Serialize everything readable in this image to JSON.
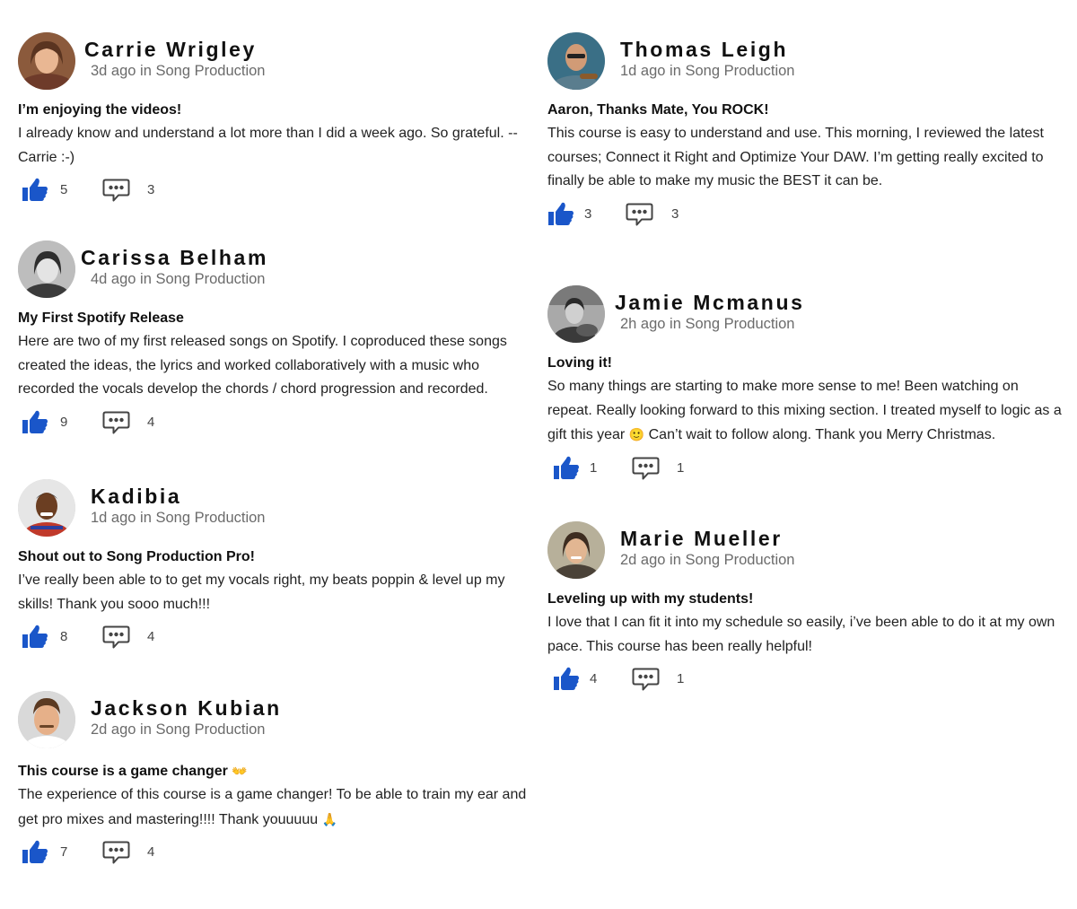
{
  "posts": [
    {
      "name": "Carrie Wrigley",
      "meta": "3d ago in Song Production",
      "title": "I’m enjoying the videos!",
      "body": "I already know and understand a lot more than I did a week ago. So grateful. -- Carrie :-)",
      "likes": "5",
      "comments": "3"
    },
    {
      "name": "Carissa Belham",
      "meta": "4d ago in Song Production",
      "title": "My First Spotify Release",
      "body": "Here are two of my first released songs on Spotify. I coproduced these songs created the ideas, the lyrics and worked collaboratively with a music who recorded the vocals develop the chords / chord progression and recorded.",
      "likes": "9",
      "comments": "4"
    },
    {
      "name": "Kadibia",
      "meta": "1d ago in Song Production",
      "title": "Shout out to Song Production Pro!",
      "body": "I’ve really been able to to get my vocals right, my beats poppin & level up my skills! Thank you sooo much!!!",
      "likes": "8",
      "comments": "4"
    },
    {
      "name": "Jackson Kubian",
      "meta": "2d ago in Song Production",
      "title": "This course is a game changer",
      "title_emoji": "👐",
      "body": "The experience of this course is a game changer! To be able to train my ear and get pro mixes and mastering!!!! Thank youuuuu",
      "body_emoji": "🙏",
      "likes": "7",
      "comments": "4"
    },
    {
      "name": "Thomas Leigh",
      "meta": "1d ago in Song Production",
      "title": "Aaron, Thanks Mate, You ROCK!",
      "body": "This course is easy to understand and use. This morning, I reviewed the latest courses; Connect it Right and Optimize Your DAW. I’m getting really excited to finally be able to make my music the BEST it can be.",
      "likes": "3",
      "comments": "3"
    },
    {
      "name": "Jamie Mcmanus",
      "meta": "2h ago in Song Production",
      "title": "Loving it!",
      "body_a": "So many things are starting to make more sense to me! Been watching on repeat. Really looking forward to this mixing section. I treated myself to logic as a gift this year",
      "body_emoji": "🙂",
      "body_b": "Can’t wait to follow along. Thank you Merry Christmas.",
      "likes": "1",
      "comments": "1"
    },
    {
      "name": "Marie Mueller",
      "meta": "2d ago in Song Production",
      "title": "Leveling up with my students!",
      "body": "I love that I can fit it into my schedule so easily, i’ve been able to do it at my own pace. This course has been really helpful!",
      "likes": "4",
      "comments": "1"
    }
  ],
  "icons": {
    "like": "thumbs-up-icon",
    "comment": "comment-bubble-icon"
  },
  "colors": {
    "accent": "#1a56c9",
    "text": "#111111",
    "muted": "#6b6b6b"
  }
}
